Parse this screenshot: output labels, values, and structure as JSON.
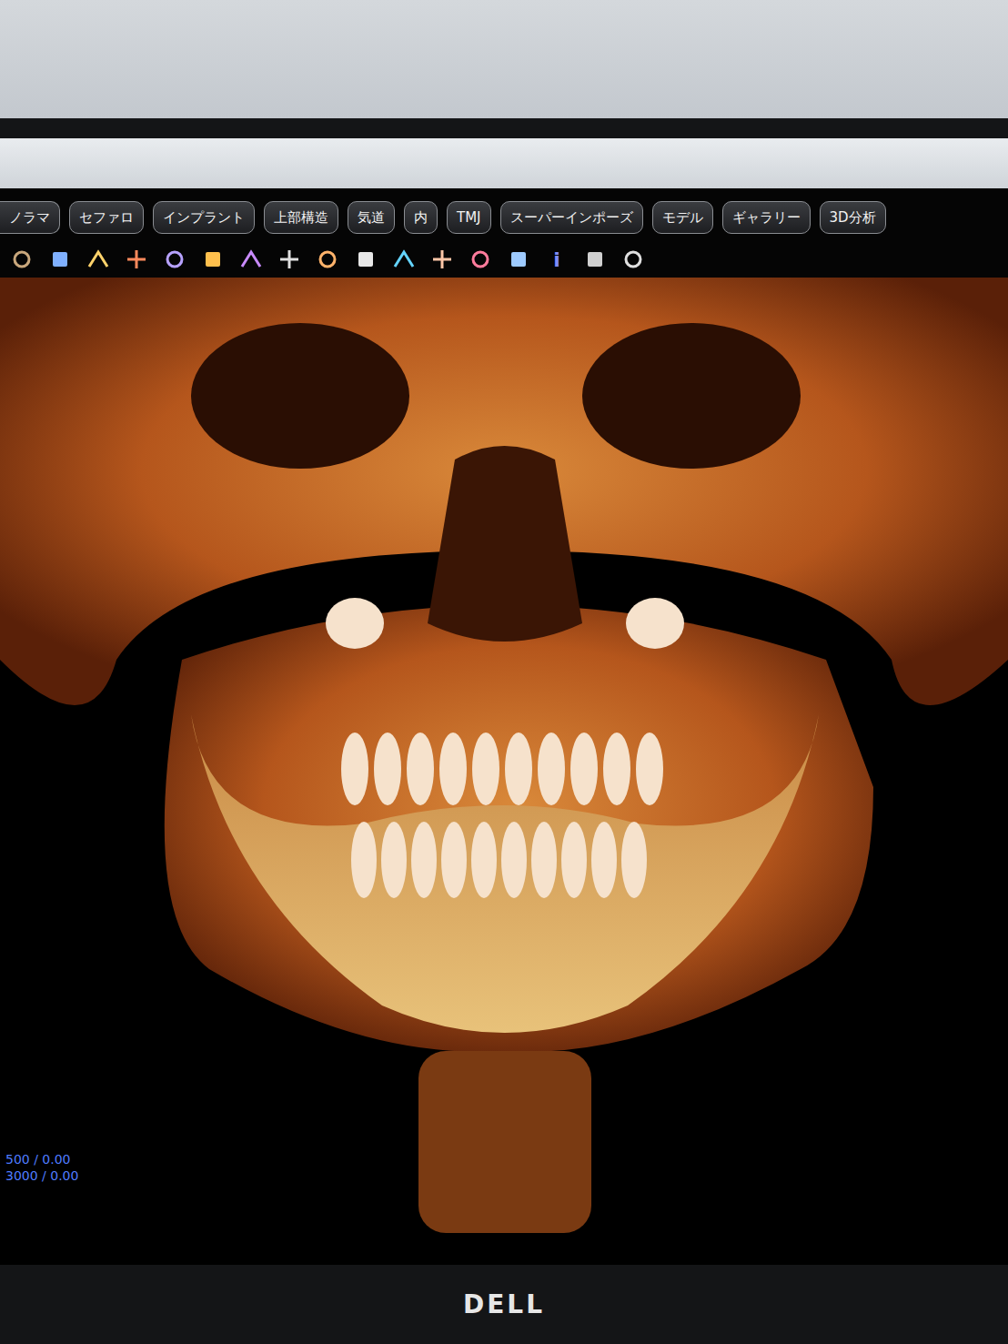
{
  "tabs": [
    {
      "label": "ノラマ",
      "selected": false
    },
    {
      "label": "セファロ",
      "selected": false
    },
    {
      "label": "インプラント",
      "selected": false
    },
    {
      "label": "上部構造",
      "selected": false
    },
    {
      "label": "気道",
      "selected": false
    },
    {
      "label": "内",
      "selected": false
    },
    {
      "label": "TMJ",
      "selected": false
    },
    {
      "label": "スーパーインポーズ",
      "selected": false
    },
    {
      "label": "モデル",
      "selected": false
    },
    {
      "label": "ギャラリー",
      "selected": false
    },
    {
      "label": "3D分析",
      "selected": false
    }
  ],
  "toolbar": {
    "info_glyph": "i"
  },
  "viewport": {
    "readouts": [
      "500 / 0.00",
      "3000 / 0.00"
    ]
  },
  "monitor": {
    "logo": "DELL"
  }
}
